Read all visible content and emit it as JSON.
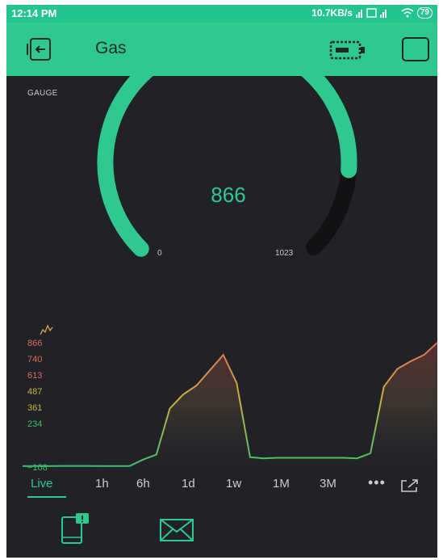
{
  "status_bar": {
    "time": "12:14 PM",
    "net_speed": "10.7KB/s",
    "battery": "79"
  },
  "app_bar": {
    "title": "Gas",
    "back_icon": "exit-icon",
    "device_icon": "device-battery-icon",
    "menu_icon": "square-icon"
  },
  "gauge": {
    "label": "GAUGE",
    "value": "866",
    "min": "0",
    "max": "1023",
    "accent_color": "#2fc98f",
    "track_color": "#111214"
  },
  "chart_data": {
    "type": "area",
    "y_ticks": [
      "866",
      "740",
      "613",
      "487",
      "361",
      "234",
      "−108"
    ],
    "y_tick_values": [
      866,
      740,
      613,
      487,
      361,
      234,
      -108
    ],
    "ylim": [
      -108,
      866
    ],
    "values": [
      -100,
      -100,
      -100,
      -99,
      -99,
      -99,
      -100,
      -100,
      -100,
      -50,
      -10,
      350,
      460,
      530,
      650,
      770,
      550,
      -30,
      -40,
      -35,
      -35,
      -35,
      -35,
      -35,
      -35,
      -40,
      0,
      520,
      660,
      720,
      770,
      866
    ],
    "series_colors": [
      "#3fbf6a",
      "#c9b23f",
      "#e06a5a"
    ]
  },
  "time_ranges": {
    "items": [
      "Live",
      "1h",
      "6h",
      "1d",
      "1w",
      "1M",
      "3M"
    ],
    "active": "Live",
    "more_icon": "more-icon",
    "export_icon": "export-icon"
  },
  "bottom_icons": [
    "notification-device-icon",
    "email-icon"
  ]
}
